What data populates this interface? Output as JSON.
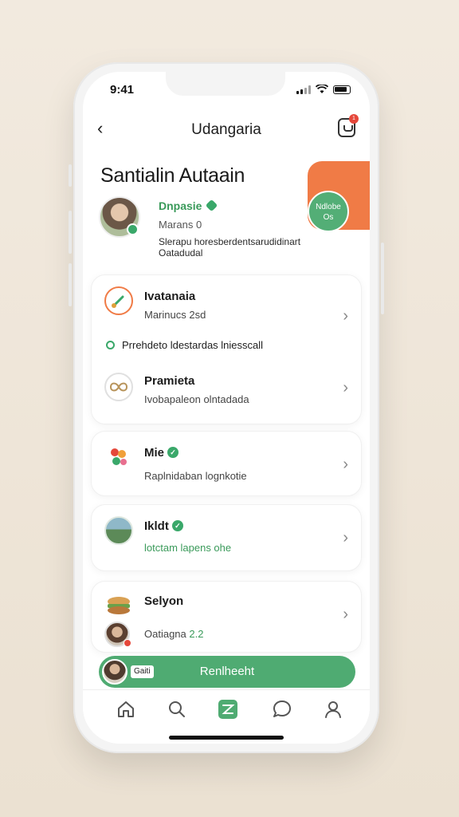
{
  "status": {
    "time": "9:41"
  },
  "topbar": {
    "title": "Udangaria",
    "badge_count": "1"
  },
  "profile": {
    "title": "Santialin Autaain",
    "name": "Dnpasie",
    "meta": "Marans 0",
    "description": "Slerapu horesberdentsarudidinart Oatadudal",
    "bubble_text": "Ndlobe\nOs"
  },
  "rows": [
    {
      "title": "Ivatanaia",
      "subtitle": "Marinucs 2sd",
      "icon": "brush-icon"
    },
    {
      "title": "Pramieta",
      "subtitle": "Ivobapaleon olntadada",
      "icon": "infinity-icon"
    },
    {
      "title": "Mie",
      "subtitle": "Raplnidaban lognkotie",
      "icon": "fruit-icon",
      "verified": true
    },
    {
      "title": "Ikldt",
      "subtitle": "lotctam lapens ohe",
      "icon": "landscape-icon",
      "verified": true
    },
    {
      "title": "Selyon",
      "subtitle": "Oatiagna",
      "subtitle_value": "2.2",
      "icon": "food-icon"
    }
  ],
  "note": "Prrehdeto ldestardas lniesscall",
  "cta": {
    "chip": "Gaiti",
    "label": "Renlheeht"
  },
  "tabbar": [
    "home-icon",
    "search-icon",
    "plan-icon",
    "chat-icon",
    "profile-icon"
  ],
  "colors": {
    "accent_green": "#4fab72",
    "accent_orange": "#f07b46",
    "badge_red": "#e5473a"
  }
}
